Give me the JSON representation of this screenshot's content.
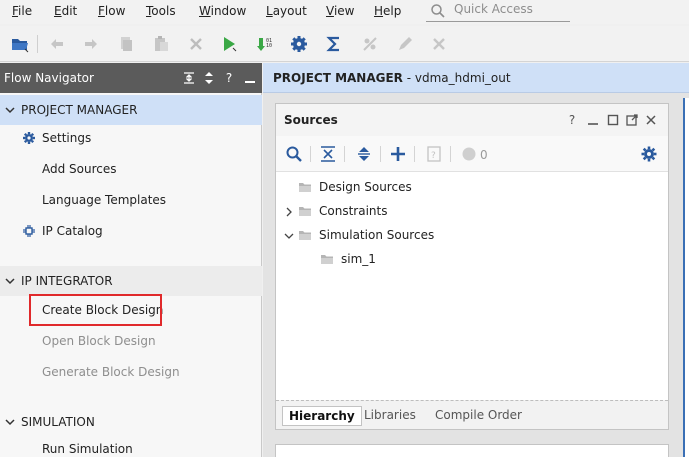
{
  "menubar": {
    "items": [
      {
        "label": "File",
        "mnemonic": "F",
        "rest": "ile"
      },
      {
        "label": "Edit",
        "mnemonic": "E",
        "rest": "dit"
      },
      {
        "label": "Flow",
        "mnemonic": "F",
        "rest": "low"
      },
      {
        "label": "Tools",
        "mnemonic": "T",
        "rest": "ools"
      },
      {
        "label": "Window",
        "mnemonic": "W",
        "rest": "indow"
      },
      {
        "label": "Layout",
        "mnemonic": "L",
        "rest": "ayout"
      },
      {
        "label": "View",
        "mnemonic": "V",
        "rest": "iew"
      },
      {
        "label": "Help",
        "mnemonic": "H",
        "rest": "elp"
      }
    ],
    "quick_access_placeholder": "Quick Access"
  },
  "toolbar": {
    "icons": [
      "open-project-icon",
      "undo-icon",
      "redo-icon",
      "copy-icon",
      "paste-icon",
      "delete-icon",
      "run-icon",
      "generate-bitstream-icon",
      "settings-icon",
      "sigma-icon",
      "auto-connect-icon",
      "edit-icon",
      "cancel-icon"
    ]
  },
  "flow_navigator": {
    "title": "Flow Navigator",
    "header_icons": [
      "collapse-all-icon",
      "expand-icon",
      "help-icon",
      "minimize-icon"
    ],
    "sections": [
      {
        "label": "PROJECT MANAGER",
        "items": [
          "Settings",
          "Add Sources",
          "Language Templates",
          "IP Catalog"
        ]
      },
      {
        "label": "IP INTEGRATOR",
        "items": [
          "Create Block Design",
          "Open Block Design",
          "Generate Block Design"
        ]
      },
      {
        "label": "SIMULATION",
        "items": [
          "Run Simulation"
        ]
      }
    ]
  },
  "project_manager": {
    "label": "PROJECT MANAGER",
    "project_name": "- vdma_hdmi_out"
  },
  "sources": {
    "title": "Sources",
    "window_icons": [
      "help-icon",
      "minimize-icon",
      "restore-icon",
      "float-icon",
      "close-icon"
    ],
    "count": "0",
    "tree": [
      {
        "label": "Design Sources",
        "expandable": false,
        "level": 0
      },
      {
        "label": "Constraints",
        "expandable": true,
        "expanded": false,
        "level": 0
      },
      {
        "label": "Simulation Sources",
        "expandable": true,
        "expanded": true,
        "level": 0
      },
      {
        "label": "sim_1",
        "expandable": false,
        "level": 1
      }
    ],
    "tabs": [
      "Hierarchy",
      "Libraries",
      "Compile Order"
    ],
    "active_tab": "Hierarchy"
  },
  "colors": {
    "highlight": "#e0292b",
    "section_active": "#cfe0f7",
    "header_dark": "#5b5b5b",
    "run_green": "#3aa845",
    "icon_blue": "#2a5a9e"
  }
}
